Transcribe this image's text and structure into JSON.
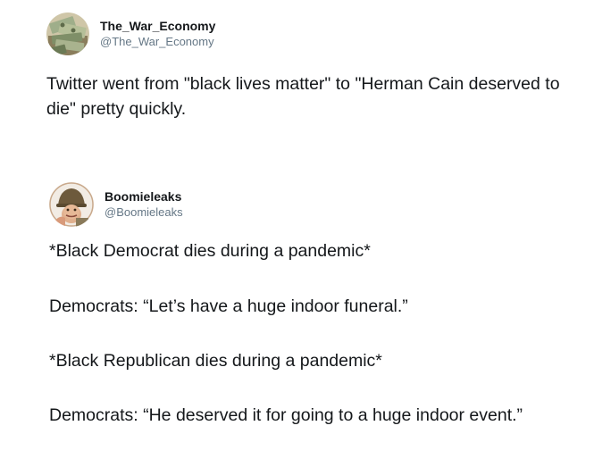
{
  "tweets": [
    {
      "display_name": "The_War_Economy",
      "handle": "@The_War_Economy",
      "avatar_icon": "stacked-cash-avatar",
      "text": "Twitter went from \"black lives matter\" to \"Herman Cain deserved to die\" pretty quickly."
    },
    {
      "display_name": "Boomieleaks",
      "handle": "@Boomieleaks",
      "avatar_icon": "soldier-helmet-avatar",
      "paragraphs": [
        "*Black Democrat dies during a pandemic*",
        "Democrats: “Let’s have a huge indoor funeral.”",
        "*Black Republican dies during a pandemic*",
        "Democrats: “He deserved it for going to a huge indoor event.”"
      ]
    }
  ],
  "colors": {
    "text": "#14171a",
    "handle": "#657786",
    "background": "#ffffff"
  }
}
